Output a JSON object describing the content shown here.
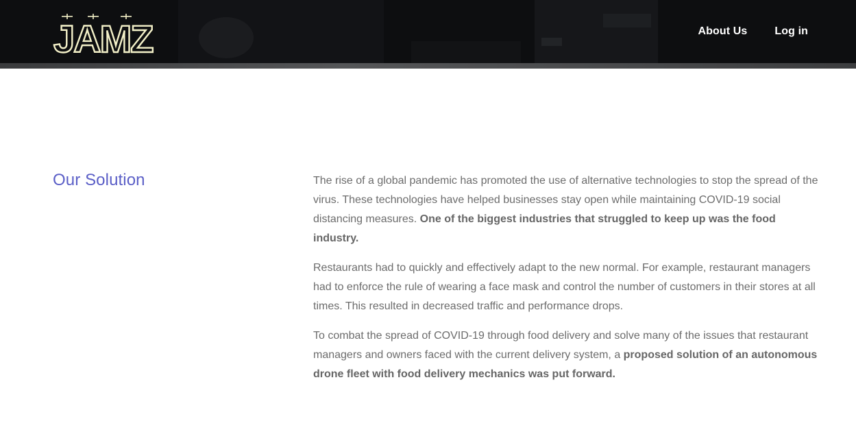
{
  "header": {
    "logo_text": "JAMZ",
    "nav": {
      "about_label": "About Us",
      "login_label": "Log in"
    }
  },
  "section": {
    "title": "Our Solution",
    "paragraphs": [
      {
        "text": "The rise of a global pandemic has promoted the use of alternative technologies to stop the spread of the virus. These technologies have helped businesses stay open while maintaining COVID-19 social distancing measures. ",
        "bold": "One of the biggest industries that struggled to keep up was the food industry."
      },
      {
        "text": "Restaurants had to quickly and effectively adapt to the new normal. For example, restaurant managers had to enforce the rule of wearing a face mask and control the number of customers in their stores at all times. This resulted in decreased traffic and performance drops.",
        "bold": ""
      },
      {
        "text": "To combat the spread of COVID-19 through food delivery and solve many of the issues that restaurant managers and owners faced with the current delivery system, a ",
        "bold": "proposed solution of an autonomous drone fleet with food delivery mechanics was put forward."
      }
    ]
  },
  "colors": {
    "header_bg": "#0b0b0c",
    "title_accent": "#5b5fc7",
    "body_text": "#6c6c6c",
    "logo_fill": "#f3f0c8"
  },
  "icons": {
    "logo": "jamz-drone-logo"
  }
}
